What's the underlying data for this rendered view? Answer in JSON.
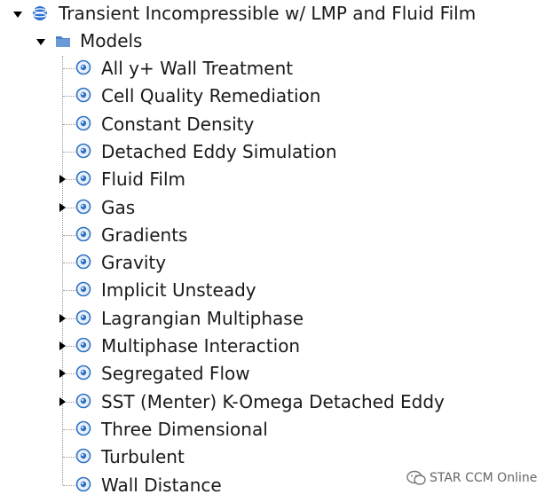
{
  "root": {
    "label": "Transient Incompressible w/ LMP and Fluid Film",
    "expanded": true,
    "icon": "simulation-sphere-icon"
  },
  "models_folder": {
    "label": "Models",
    "expanded": true,
    "icon": "folder-icon"
  },
  "models": [
    {
      "label": "All y+ Wall Treatment",
      "expandable": false
    },
    {
      "label": "Cell Quality Remediation",
      "expandable": false
    },
    {
      "label": "Constant Density",
      "expandable": false
    },
    {
      "label": "Detached Eddy Simulation",
      "expandable": false
    },
    {
      "label": "Fluid Film",
      "expandable": true
    },
    {
      "label": "Gas",
      "expandable": true
    },
    {
      "label": "Gradients",
      "expandable": false
    },
    {
      "label": "Gravity",
      "expandable": false
    },
    {
      "label": "Implicit Unsteady",
      "expandable": false
    },
    {
      "label": "Lagrangian Multiphase",
      "expandable": true
    },
    {
      "label": "Multiphase Interaction",
      "expandable": true
    },
    {
      "label": "Segregated Flow",
      "expandable": true
    },
    {
      "label": "SST (Menter) K-Omega Detached Eddy",
      "expandable": true
    },
    {
      "label": "Three Dimensional",
      "expandable": false
    },
    {
      "label": "Turbulent",
      "expandable": false
    },
    {
      "label": "Wall Distance",
      "expandable": false
    }
  ],
  "model_icon": "model-node-icon",
  "watermark": {
    "text": "STAR CCM Online",
    "icon": "wechat-icon"
  },
  "colors": {
    "model_icon_blue": "#2f72c4",
    "folder_blue": "#4a7fc8",
    "sphere_blue": "#2a6fd6"
  }
}
